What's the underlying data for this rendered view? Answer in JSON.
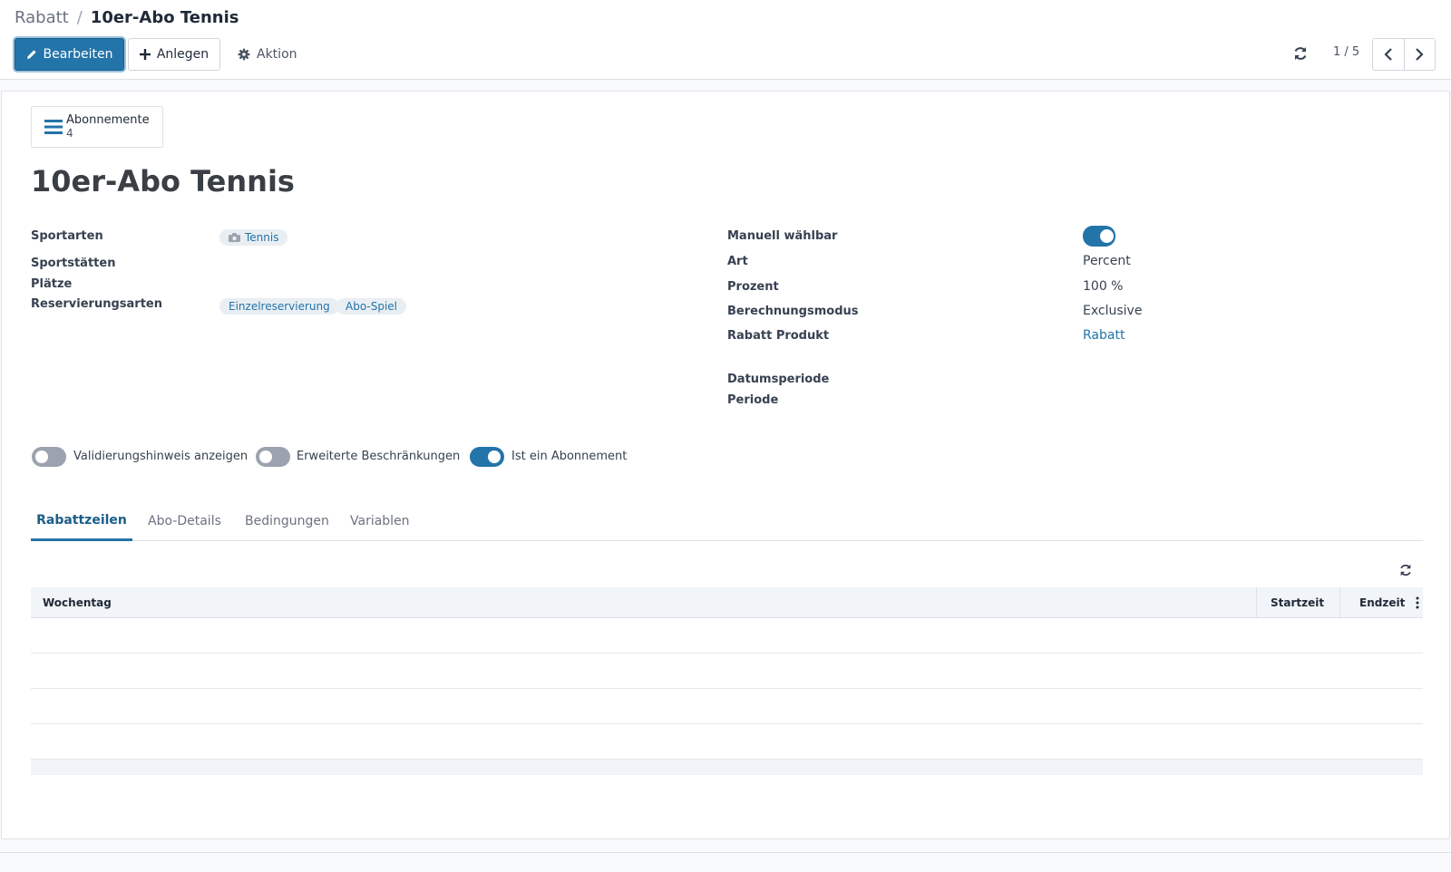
{
  "breadcrumb": {
    "parent": "Rabatt",
    "separator": "/",
    "current": "10er-Abo Tennis"
  },
  "toolbar": {
    "edit_label": "Bearbeiten",
    "create_label": "Anlegen",
    "action_label": "Aktion",
    "pager_value": "1 / 5"
  },
  "smart_button": {
    "label": "Abonnemente",
    "count": "4",
    "icon": "list-icon"
  },
  "record": {
    "title": "10er-Abo Tennis"
  },
  "left_fields": {
    "sportarten_label": "Sportarten",
    "sportarten_tags": [
      "Tennis"
    ],
    "sportstaetten_label": "Sportstätten",
    "plaetze_label": "Plätze",
    "reservierungsarten_label": "Reservierungsarten",
    "reservierungsarten_tags": [
      "Einzelreservierung",
      "Abo-Spiel"
    ]
  },
  "right_fields": {
    "manuell_label": "Manuell wählbar",
    "manuell_value": true,
    "art_label": "Art",
    "art_value": "Percent",
    "prozent_label": "Prozent",
    "prozent_value": "100 %",
    "modus_label": "Berechnungsmodus",
    "modus_value": "Exclusive",
    "produkt_label": "Rabatt Produkt",
    "produkt_value": "Rabatt",
    "datumsperiode_label": "Datumsperiode",
    "periode_label": "Periode"
  },
  "toggles": [
    {
      "label": "Validierungshinweis anzeigen",
      "on": false
    },
    {
      "label": "Erweiterte Beschränkungen",
      "on": false
    },
    {
      "label": "Ist ein Abonnement",
      "on": true
    }
  ],
  "tabs": [
    {
      "label": "Rabattzeilen",
      "active": true
    },
    {
      "label": "Abo-Details",
      "active": false
    },
    {
      "label": "Bedingungen",
      "active": false
    },
    {
      "label": "Variablen",
      "active": false
    }
  ],
  "table": {
    "columns": [
      "Wochentag",
      "Startzeit",
      "Endzeit"
    ],
    "rows": []
  },
  "colors": {
    "primary": "#2374a9",
    "tag_bg": "#e9eef3",
    "header_bg": "#f1f4f8"
  }
}
